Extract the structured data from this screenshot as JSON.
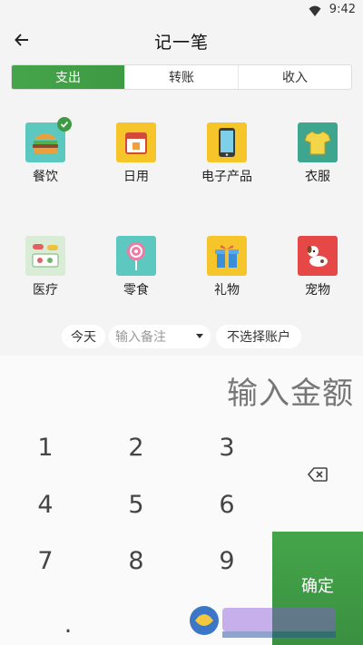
{
  "status_bar": {
    "time": "9:42"
  },
  "app_bar": {
    "title": "记一笔"
  },
  "tabs": [
    {
      "label": "支出",
      "active": true
    },
    {
      "label": "转账",
      "active": false
    },
    {
      "label": "收入",
      "active": false
    }
  ],
  "categories": [
    {
      "label": "餐饮",
      "icon": "burger-icon",
      "selected": true
    },
    {
      "label": "日用",
      "icon": "calendar-icon",
      "selected": false
    },
    {
      "label": "电子产品",
      "icon": "phone-icon",
      "selected": false
    },
    {
      "label": "衣服",
      "icon": "shirt-icon",
      "selected": false
    },
    {
      "label": "医疗",
      "icon": "pills-icon",
      "selected": false
    },
    {
      "label": "零食",
      "icon": "lollipop-icon",
      "selected": false
    },
    {
      "label": "礼物",
      "icon": "gift-icon",
      "selected": false
    },
    {
      "label": "宠物",
      "icon": "dog-icon",
      "selected": false
    }
  ],
  "options": {
    "date_label": "今天",
    "note_placeholder": "输入备注",
    "account_label": "不选择账户"
  },
  "keypad": {
    "amount_placeholder": "输入金额",
    "keys": [
      "1",
      "2",
      "3",
      "4",
      "5",
      "6",
      "7",
      "8",
      "9",
      "."
    ],
    "confirm_label": "确定"
  },
  "colors": {
    "accent": "#3e9a43",
    "background": "#f4f4f4"
  }
}
